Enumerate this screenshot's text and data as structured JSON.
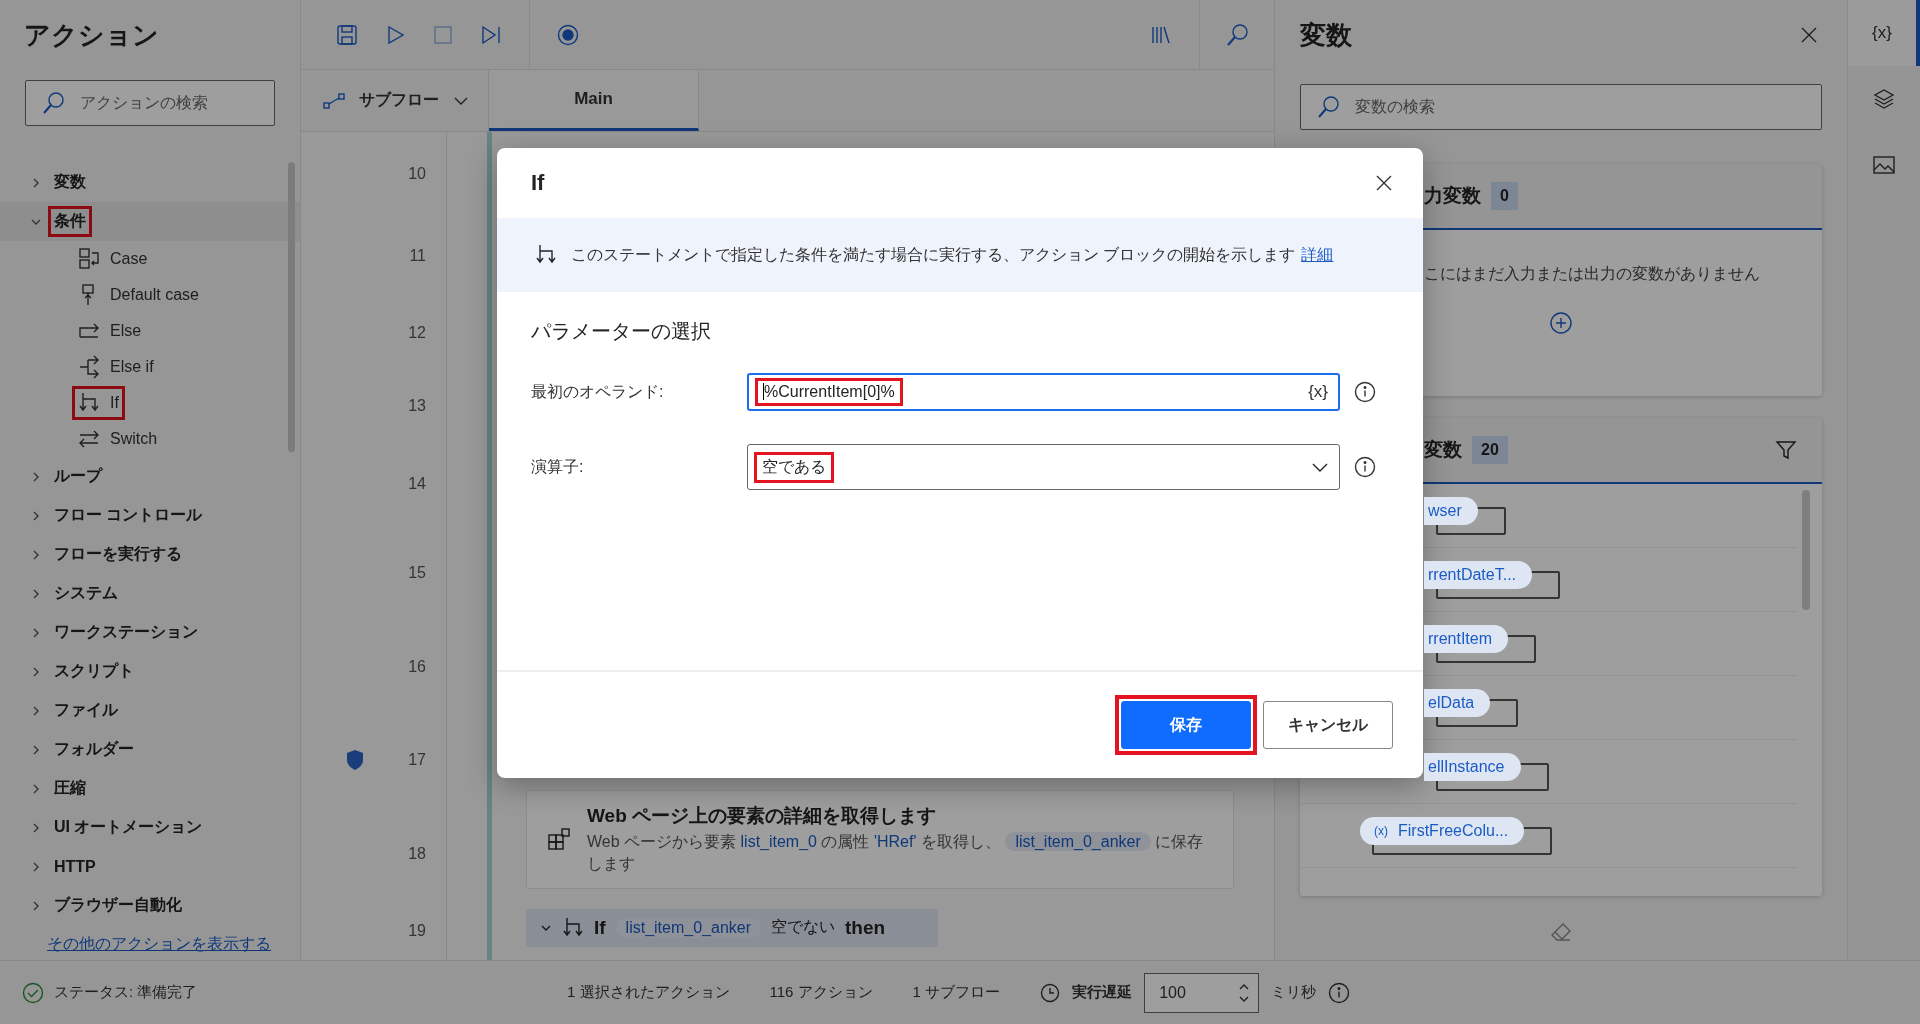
{
  "actions_panel": {
    "title": "アクション",
    "search": {
      "placeholder": "アクションの検索"
    },
    "categories": [
      {
        "label": "変数",
        "expanded": false,
        "highlighted": false
      },
      {
        "label": "条件",
        "expanded": true,
        "highlighted": true,
        "children": [
          {
            "label": "Case",
            "highlighted": false
          },
          {
            "label": "Default case",
            "highlighted": false
          },
          {
            "label": "Else",
            "highlighted": false
          },
          {
            "label": "Else if",
            "highlighted": false
          },
          {
            "label": "If",
            "highlighted": true
          },
          {
            "label": "Switch",
            "highlighted": false
          }
        ]
      },
      {
        "label": "ループ",
        "expanded": false,
        "highlighted": false
      },
      {
        "label": "フロー コントロール",
        "expanded": false,
        "highlighted": false
      },
      {
        "label": "フローを実行する",
        "expanded": false,
        "highlighted": false
      },
      {
        "label": "システム",
        "expanded": false,
        "highlighted": false
      },
      {
        "label": "ワークステーション",
        "expanded": false,
        "highlighted": false
      },
      {
        "label": "スクリプト",
        "expanded": false,
        "highlighted": false
      },
      {
        "label": "ファイル",
        "expanded": false,
        "highlighted": false
      },
      {
        "label": "フォルダー",
        "expanded": false,
        "highlighted": false
      },
      {
        "label": "圧縮",
        "expanded": false,
        "highlighted": false
      },
      {
        "label": "UI オートメーション",
        "expanded": false,
        "highlighted": false
      },
      {
        "label": "HTTP",
        "expanded": false,
        "highlighted": false
      },
      {
        "label": "ブラウザー自動化",
        "expanded": false,
        "highlighted": false
      }
    ],
    "more_link": "その他のアクションを表示する"
  },
  "subflow_button": {
    "label": "サブフロー"
  },
  "tabs": [
    {
      "label": "Main",
      "selected": true
    }
  ],
  "editor": {
    "line_numbers": [
      "10",
      "11",
      "12",
      "13",
      "14",
      "15",
      "16",
      "17",
      "18",
      "19"
    ],
    "steps": [
      {
        "kind": "action",
        "title": "Web ページ上の要素の詳細を取得します",
        "description": [
          {
            "kind": "plain",
            "text": "Web ページから要素"
          },
          {
            "kind": "variable",
            "text": "list_item_0"
          },
          {
            "kind": "plain",
            "text": "の属性"
          },
          {
            "kind": "variable",
            "text": "'HRef'"
          },
          {
            "kind": "plain",
            "text": "を取得し、"
          },
          {
            "kind": "chip",
            "text": "list_item_0_anker"
          },
          {
            "kind": "plain",
            "text": "に保存します"
          }
        ]
      },
      {
        "kind": "if",
        "keyword": "If",
        "variable": "list_item_0_anker",
        "operator": "空でない",
        "then": "then"
      }
    ]
  },
  "variables_panel": {
    "title": "変数",
    "search": {
      "placeholder": "変数の検索"
    },
    "io_section": {
      "title": "力変数",
      "count": "0",
      "empty_text": "こにはまだ入力または出力の変数がありません"
    },
    "flow_section": {
      "title": "変数",
      "count": "20",
      "items": [
        {
          "name": "wser"
        },
        {
          "name": "rrentDateT..."
        },
        {
          "name": "rrentItem"
        },
        {
          "name": "elData"
        },
        {
          "name": "ellInstance"
        },
        {
          "name": "FirstFreeColu...",
          "prefix": "(x)"
        }
      ]
    }
  },
  "side_rail": [
    {
      "kind": "variables",
      "label": "{x}",
      "selected": true
    },
    {
      "kind": "layers",
      "selected": false
    },
    {
      "kind": "image",
      "selected": false
    }
  ],
  "status_bar": {
    "status": "ステータス: 準備完了",
    "selected_actions": "1 選択されたアクション",
    "action_count": "116 アクション",
    "subflow_count": "1 サブフロー",
    "delay_label": "実行遅延",
    "delay_value": "100",
    "delay_unit": "ミリ秒"
  },
  "dialog": {
    "title": "If",
    "description": "このステートメントで指定した条件を満たす場合に実行する、アクション ブロックの開始を示します",
    "link": "詳細",
    "section_title": "パラメーターの選択",
    "fields": [
      {
        "kind": "text",
        "label": "最初のオペランド:",
        "value": "%CurrentItem[0]%",
        "suffix": "{x}",
        "focused": true,
        "highlighted": true
      },
      {
        "kind": "dropdown",
        "label": "演算子:",
        "value": "空である",
        "focused": false,
        "highlighted": true
      }
    ],
    "buttons": [
      {
        "label": "保存",
        "primary": true,
        "highlighted": true
      },
      {
        "label": "キャンセル",
        "primary": false,
        "highlighted": false
      }
    ]
  }
}
